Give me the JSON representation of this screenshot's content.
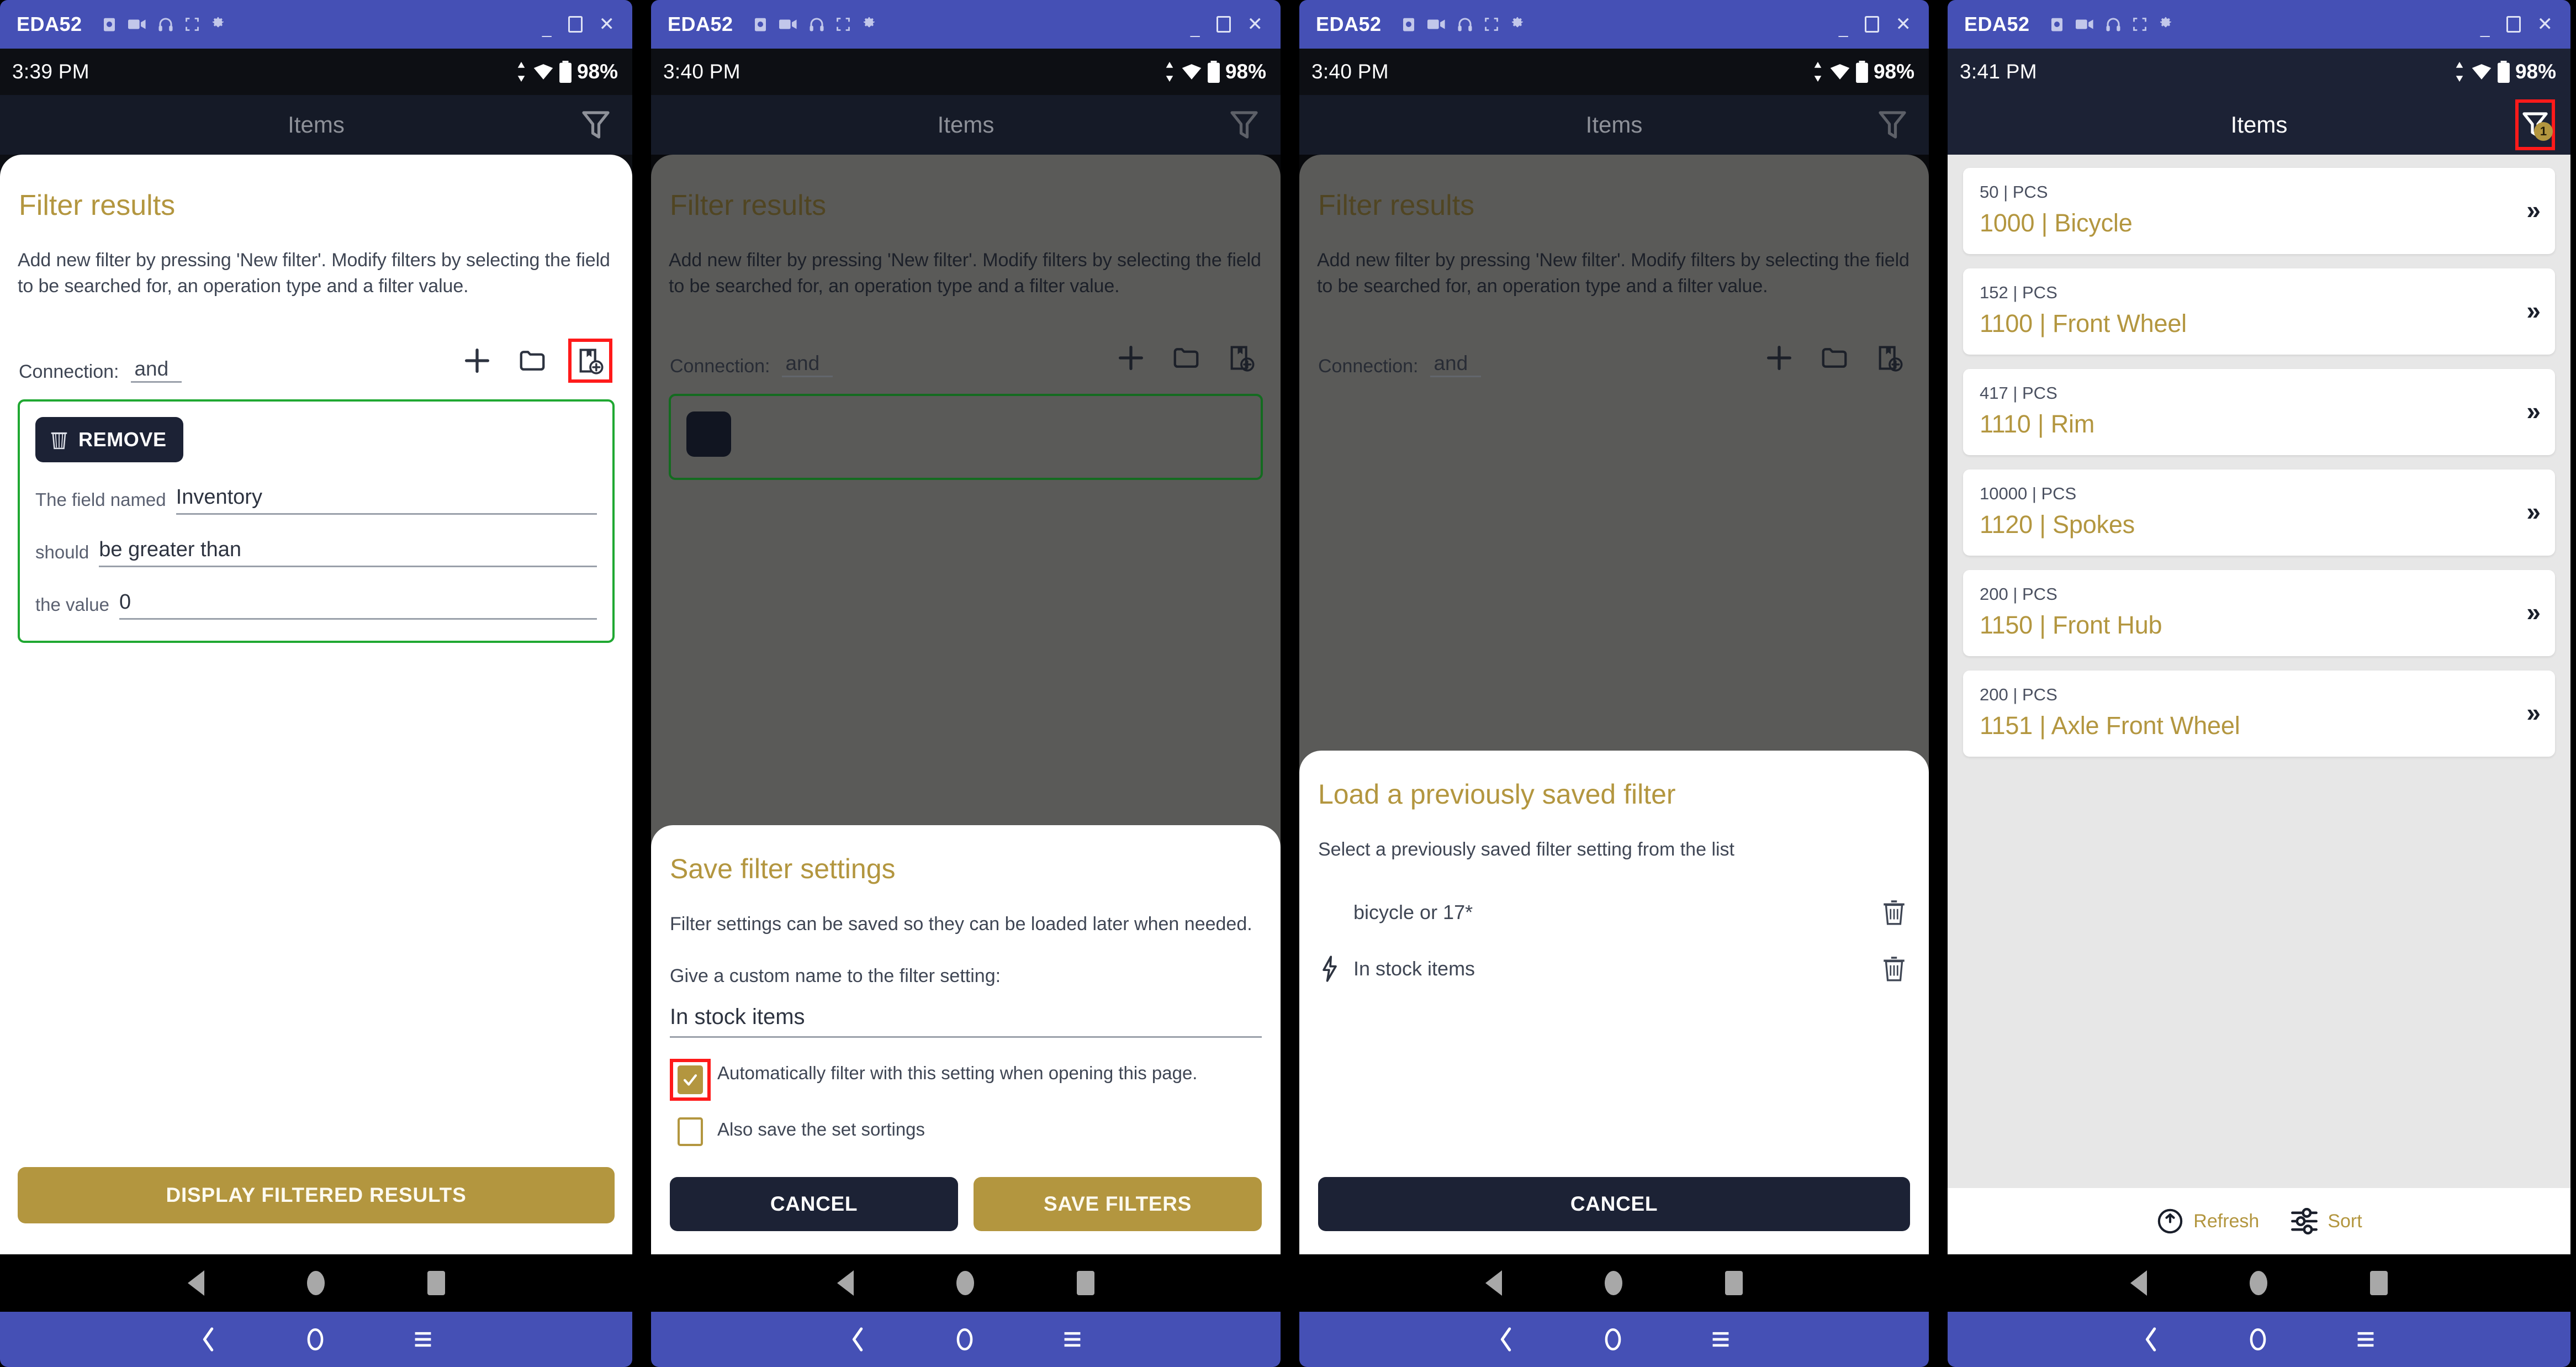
{
  "emulator": {
    "device_name": "EDA52",
    "toolbar_icons": [
      "screenshot-icon",
      "record-icon",
      "headphone-icon",
      "fullscreen-icon",
      "settings-icon"
    ],
    "window_controls": {
      "minimize": "_",
      "maximize": "□",
      "close": "✕"
    }
  },
  "colors": {
    "accent_gold": "#b3963f",
    "navy": "#1c2235",
    "highlight_red": "#ff1a1a",
    "valid_green": "#20a832",
    "host_blue": "#4550b5"
  },
  "panels": [
    {
      "status": {
        "time": "3:39 PM",
        "battery": "98%",
        "signal": "5"
      },
      "appbar": {
        "title": "Items",
        "filter_icon": "filter-icon",
        "filter_badge": null
      },
      "sheet": {
        "title": "Filter results",
        "description": "Add new filter by pressing 'New filter'. Modify filters by selecting the field to be searched for, an operation type and a filter value.",
        "connection_label": "Connection:",
        "connection_value": "and",
        "actions": [
          {
            "name": "add-filter-icon",
            "highlighted": false
          },
          {
            "name": "load-filter-folder-icon",
            "highlighted": false
          },
          {
            "name": "save-filter-icon",
            "highlighted": true
          }
        ],
        "condition": {
          "remove_label": "REMOVE",
          "remove_icon": "trash-icon",
          "field_label": "The field named",
          "field_value": "Inventory",
          "op_label": "should",
          "op_value": "be greater than",
          "value_label": "the value",
          "value_value": "0"
        },
        "primary_button": "DISPLAY FILTERED RESULTS"
      }
    },
    {
      "status": {
        "time": "3:40 PM",
        "battery": "98%",
        "signal": "5"
      },
      "appbar": {
        "title": "Items",
        "filter_icon": "filter-icon",
        "filter_badge": null
      },
      "dialog": {
        "title": "Save filter settings",
        "text": "Filter settings can be saved so they can be loaded later when needed.",
        "label": "Give a custom name to the filter setting:",
        "input_value": "In stock items",
        "input_placeholder": "",
        "checkboxes": [
          {
            "label": "Automatically filter with this setting when opening this page.",
            "checked": true,
            "highlighted": true
          },
          {
            "label": "Also save the set sortings",
            "checked": false,
            "highlighted": false
          }
        ],
        "cancel_label": "CANCEL",
        "confirm_label": "SAVE FILTERS"
      }
    },
    {
      "status": {
        "time": "3:40 PM",
        "battery": "98%",
        "signal": "5"
      },
      "appbar": {
        "title": "Items",
        "filter_icon": "filter-icon",
        "filter_badge": null
      },
      "dialog": {
        "title": "Load a previously saved filter",
        "text": "Select a previously saved filter setting from the list",
        "saved_filters": [
          {
            "name": "bicycle or 17*",
            "auto": false,
            "delete_icon": "trash-icon"
          },
          {
            "name": "In stock items",
            "auto": true,
            "auto_icon": "lightning-icon",
            "delete_icon": "trash-icon"
          }
        ],
        "cancel_label": "CANCEL"
      }
    },
    {
      "status": {
        "time": "3:41 PM",
        "battery": "98%",
        "signal": "5"
      },
      "appbar": {
        "title": "Items",
        "filter_icon": "filter-icon",
        "filter_badge": "1"
      },
      "items": [
        {
          "qty": "50 | PCS",
          "name": "1000 | Bicycle"
        },
        {
          "qty": "152 | PCS",
          "name": "1100 | Front Wheel"
        },
        {
          "qty": "417 | PCS",
          "name": "1110 | Rim"
        },
        {
          "qty": "10000 | PCS",
          "name": "1120 | Spokes"
        },
        {
          "qty": "200 | PCS",
          "name": "1150 | Front Hub"
        },
        {
          "qty": "200 | PCS",
          "name": "1151 | Axle Front Wheel"
        }
      ],
      "footer": {
        "refresh_label": "Refresh",
        "refresh_icon": "refresh-icon",
        "sort_label": "Sort",
        "sort_icon": "sliders-icon"
      }
    }
  ]
}
